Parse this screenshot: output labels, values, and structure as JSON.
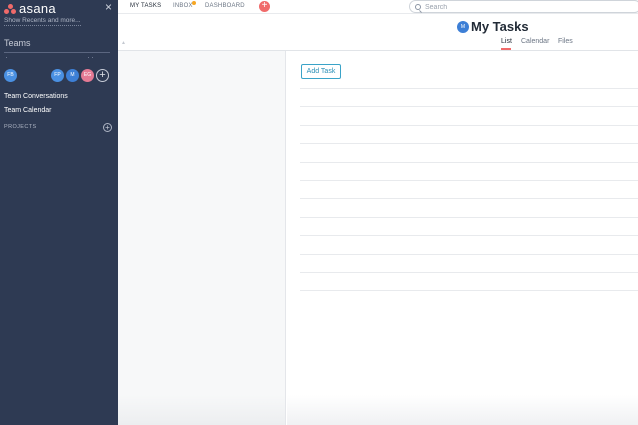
{
  "sidebar": {
    "logo_text": "asana",
    "close_icon": "×",
    "show_recents": "Show Recents and more...",
    "teams_label": "Teams",
    "members": [
      {
        "initials": "FB",
        "color": "#4a90e2"
      },
      {
        "initials": "FP",
        "color": "#4a90e2"
      },
      {
        "initials": "M",
        "color": "#3d7fd6"
      },
      {
        "initials": "EG",
        "color": "#e57a94"
      }
    ],
    "add_member_icon": "+",
    "links": [
      "Team Conversations",
      "Team Calendar"
    ],
    "projects_label": "PROJECTS",
    "add_project_icon": "+"
  },
  "topnav": {
    "tabs": [
      "MY TASKS",
      "INBOX",
      "DASHBOARD"
    ],
    "inbox_badge_color": "#f6a623",
    "quick_add_icon": "+",
    "search_placeholder": "Search"
  },
  "header": {
    "avatar_initials": "M",
    "title": "My Tasks",
    "views": [
      "List",
      "Calendar",
      "Files"
    ],
    "active_view": "List"
  },
  "tasks": {
    "add_task_label": "Add Task",
    "rows": 12
  },
  "colors": {
    "sidebar_bg": "#2e3a53",
    "accent": "#f06a6a",
    "link_button": "#2a8fb6"
  }
}
